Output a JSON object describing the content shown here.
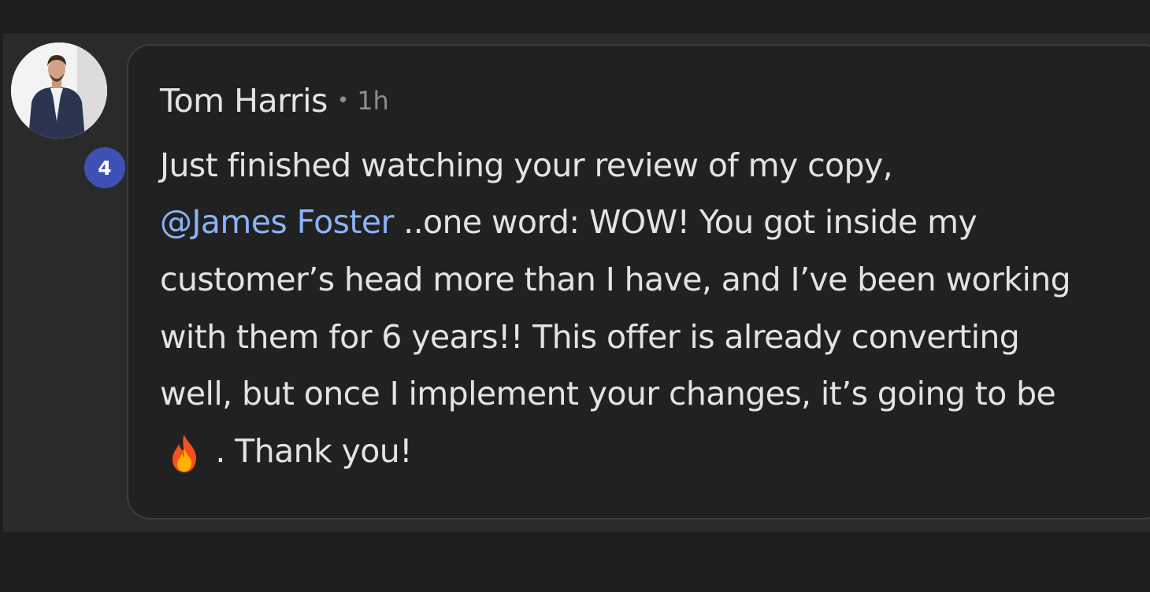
{
  "comment": {
    "author": "Tom Harris",
    "separator": "•",
    "time_ago": "1h",
    "level_badge": "4",
    "mention": "@James Foster",
    "lines": [
      "Just finished watching your review of my copy,",
      " ..one word: WOW! You got inside my",
      "customer’s head more than I have, and I’ve been working",
      "with them for 6 years!! This offer is already converting",
      "well, but once I implement your changes, it’s going to be",
      " . Thank you!"
    ],
    "emoji": "fire-icon"
  },
  "colors": {
    "page_bg": "#1e1e1e",
    "bubble_bg": "#212121",
    "text": "#e3e3e3",
    "mention": "#8ab4f8",
    "badge": "#3f51b5"
  }
}
